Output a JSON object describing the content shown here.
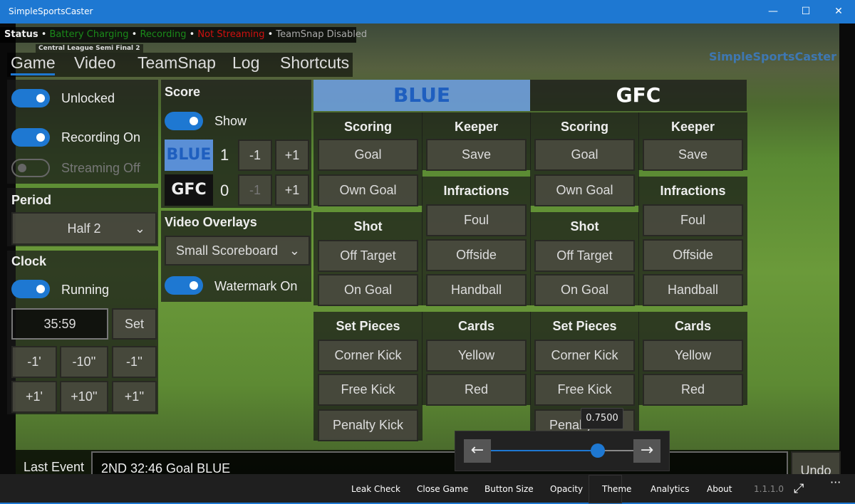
{
  "window": {
    "title": "SimpleSportsCaster"
  },
  "status": {
    "label": "Status",
    "items": [
      {
        "text": "Battery Charging",
        "color": "#1a8a1a"
      },
      {
        "text": "Recording",
        "color": "#1a8a1a"
      },
      {
        "text": "Not Streaming",
        "color": "#d01010"
      },
      {
        "text": "TeamSnap Disabled",
        "color": "#aaaaaa"
      }
    ]
  },
  "game_name": "Central League Semi Final 2",
  "watermark": "SimpleSportsCaster",
  "tabs": [
    "Game",
    "Video",
    "TeamSnap",
    "Log",
    "Shortcuts"
  ],
  "active_tab": "Game",
  "toggles": {
    "unlocked": "Unlocked",
    "recording": "Recording On",
    "streaming": "Streaming Off"
  },
  "period": {
    "label": "Period",
    "value": "Half 2"
  },
  "clock": {
    "label": "Clock",
    "running": "Running",
    "time": "35:59",
    "set": "Set",
    "adjust": [
      "-1'",
      "-10''",
      "-1''",
      "+1'",
      "+10''",
      "+1''"
    ]
  },
  "score": {
    "label": "Score",
    "show": "Show",
    "teams": [
      {
        "name": "BLUE",
        "score": "1"
      },
      {
        "name": "GFC",
        "score": "0"
      }
    ],
    "minus": "-1",
    "plus": "+1"
  },
  "overlays": {
    "label": "Video Overlays",
    "value": "Small Scoreboard",
    "watermark": "Watermark On"
  },
  "teams": [
    {
      "name": "BLUE",
      "color": "#1f5fbf"
    },
    {
      "name": "GFC",
      "color": "#ffffff"
    }
  ],
  "actions": {
    "scoring": {
      "label": "Scoring",
      "buttons": [
        "Goal",
        "Own Goal"
      ]
    },
    "shot": {
      "label": "Shot",
      "buttons": [
        "Off Target",
        "On Goal"
      ]
    },
    "set_pieces": {
      "label": "Set Pieces",
      "buttons": [
        "Corner Kick",
        "Free Kick",
        "Penalty Kick"
      ]
    },
    "keeper": {
      "label": "Keeper",
      "buttons": [
        "Save"
      ]
    },
    "infractions": {
      "label": "Infractions",
      "buttons": [
        "Foul",
        "Offside",
        "Handball"
      ]
    },
    "cards": {
      "label": "Cards",
      "buttons": [
        "Yellow",
        "Red"
      ]
    }
  },
  "last_event": {
    "label": "Last Event",
    "value": "2ND 32:46 Goal BLUE",
    "undo": "Undo"
  },
  "slider": {
    "value": 0.75,
    "tooltip": "0.7500"
  },
  "commands": [
    "Leak Check",
    "Close Game",
    "Button Size",
    "Opacity",
    "Theme",
    "Analytics",
    "About"
  ],
  "version": "1.1.1.0"
}
